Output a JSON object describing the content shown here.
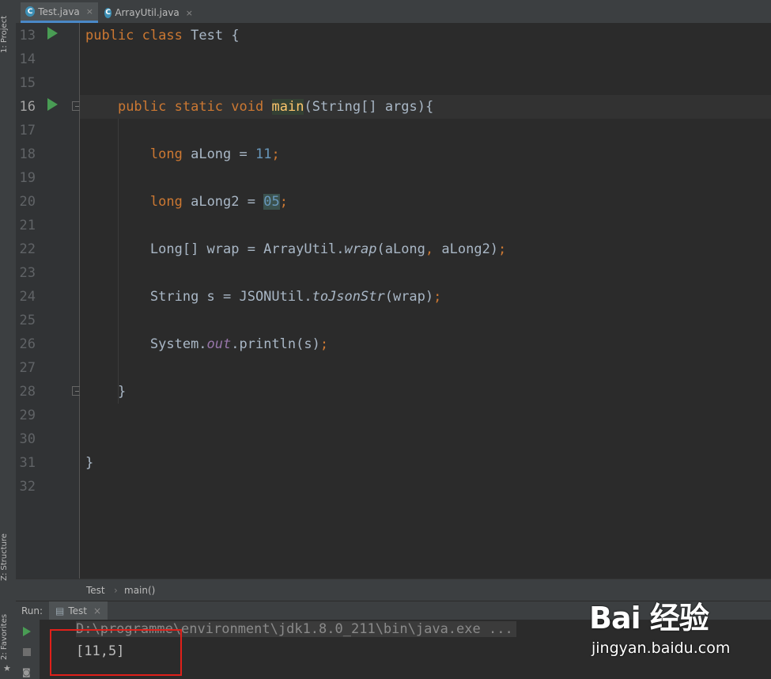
{
  "left_strip": {
    "project_label": "1: Project",
    "structure_label": "Z: Structure",
    "favorites_label": "2: Favorites"
  },
  "tabs": [
    {
      "label": "Test.java",
      "icon": "java-class-icon",
      "close": "×",
      "active": true
    },
    {
      "label": "ArrayUtil.java",
      "icon": "java-class-icon",
      "close": "×",
      "active": false
    }
  ],
  "gutter": {
    "line_numbers": [
      "13",
      "14",
      "15",
      "16",
      "17",
      "18",
      "19",
      "20",
      "21",
      "22",
      "23",
      "24",
      "25",
      "26",
      "27",
      "28",
      "29",
      "30",
      "31",
      "32"
    ]
  },
  "code": {
    "l13": {
      "kw1": "public",
      "kw2": "class",
      "name": "Test",
      "brace": "{"
    },
    "l16": {
      "kw1": "public",
      "kw2": "static",
      "kw3": "void",
      "m": "m",
      "ain": "ain",
      "sig": "(String[] args){"
    },
    "l18": {
      "kw": "long",
      "var": "aLong = ",
      "num": "11",
      "semi": ";"
    },
    "l20": {
      "kw": "long",
      "var": "aLong2 = ",
      "num": "05",
      "semi": ";"
    },
    "l22": {
      "pre": "Long[] wrap = ArrayUtil.",
      "call": "wrap",
      "args1": "(aLong",
      "comma": ",",
      "args2": " aLong2)",
      "semi": ";"
    },
    "l24": {
      "pre": "String s = JSONUtil.",
      "call": "toJsonStr",
      "args": "(wrap)",
      "semi": ";"
    },
    "l26": {
      "pre": "System.",
      "field": "out",
      "call": ".println(s)",
      "semi": ";"
    },
    "l28": {
      "brace": "}"
    },
    "l31": {
      "brace": "}"
    }
  },
  "breadcrumb": {
    "cls": "Test",
    "sep": "›",
    "method": "main()"
  },
  "run": {
    "label": "Run:",
    "tab_label": "Test",
    "tab_close": "×",
    "command": "D:\\programme\\environment\\jdk1.8.0_211\\bin\\java.exe ...",
    "output": "[11,5]"
  },
  "watermark": {
    "logo": "Bai 经验",
    "url": "jingyan.baidu.com"
  },
  "colors": {
    "keyword": "#cc7832",
    "number": "#6897bb",
    "static_field": "#9876aa",
    "text": "#a9b7c6",
    "highlight_box": "#e0201a",
    "run_icon": "#499c54"
  }
}
